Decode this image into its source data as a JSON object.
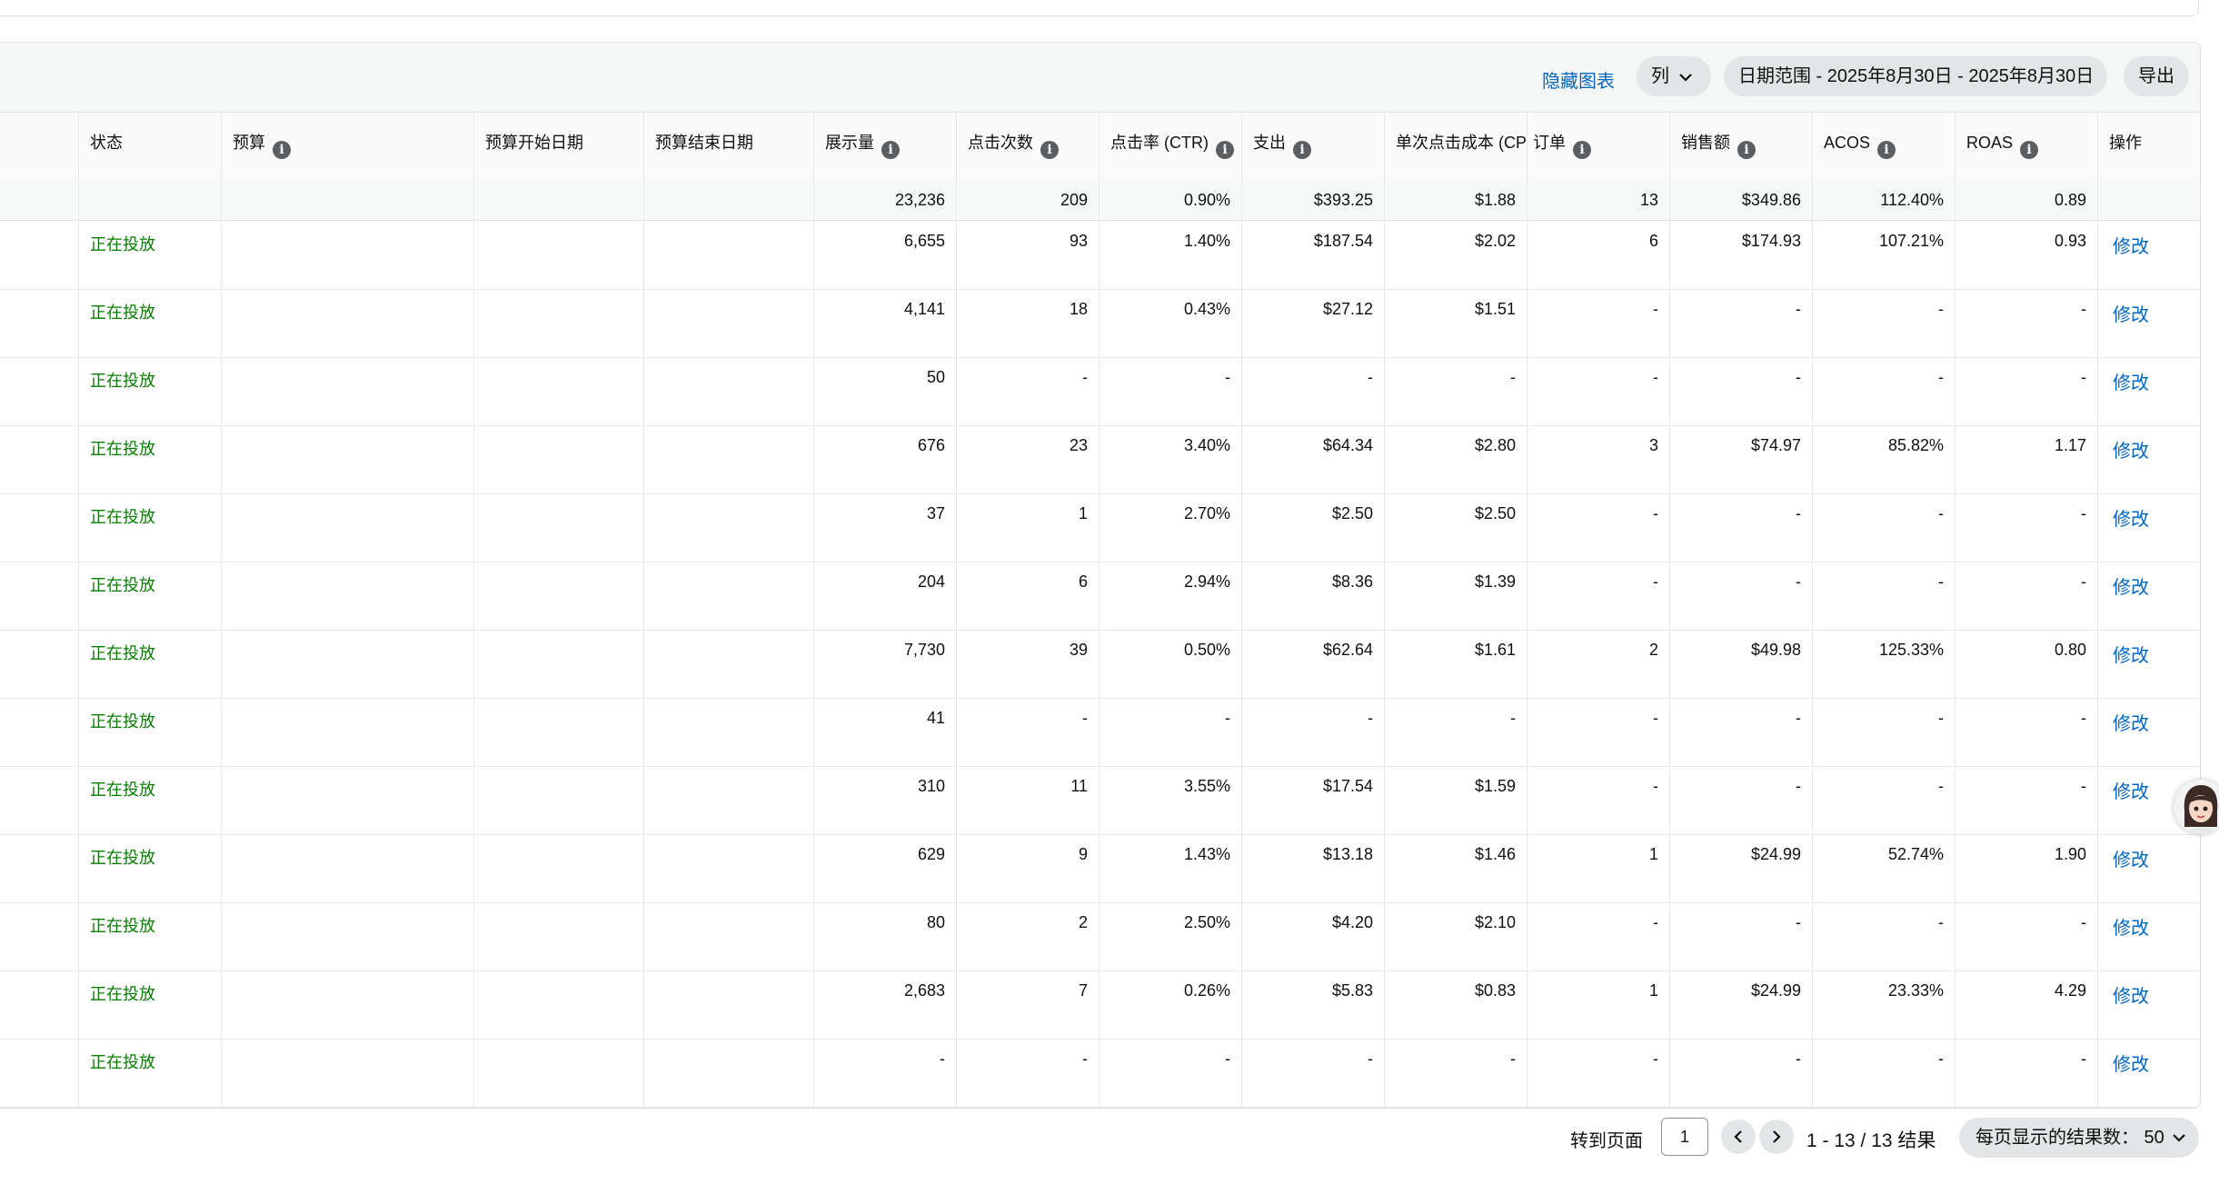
{
  "toolbar": {
    "hide_chart": "隐藏图表",
    "columns": "列",
    "date_range": "日期范围 - 2025年8月30日 - 2025年8月30日",
    "export": "导出"
  },
  "columns": [
    "状态",
    "预算",
    "预算开始日期",
    "预算结束日期",
    "展示量",
    "点击次数",
    "点击率 (CTR)",
    "支出",
    "单次点击成本 (CPC)",
    "订单",
    "销售额",
    "ACOS",
    "ROAS",
    "操作"
  ],
  "totals": {
    "impressions": "23,236",
    "clicks": "209",
    "ctr": "0.90%",
    "spend": "$393.25",
    "cpc": "$1.88",
    "orders": "13",
    "sales": "$349.86",
    "acos": "112.40%",
    "roas": "0.89"
  },
  "rows": [
    {
      "status": "正在投放",
      "impressions": "6,655",
      "clicks": "93",
      "ctr": "1.40%",
      "spend": "$187.54",
      "cpc": "$2.02",
      "orders": "6",
      "sales": "$174.93",
      "acos": "107.21%",
      "roas": "0.93",
      "action": "修改"
    },
    {
      "status": "正在投放",
      "impressions": "4,141",
      "clicks": "18",
      "ctr": "0.43%",
      "spend": "$27.12",
      "cpc": "$1.51",
      "orders": "-",
      "sales": "-",
      "acos": "-",
      "roas": "-",
      "action": "修改"
    },
    {
      "status": "正在投放",
      "impressions": "50",
      "clicks": "-",
      "ctr": "-",
      "spend": "-",
      "cpc": "-",
      "orders": "-",
      "sales": "-",
      "acos": "-",
      "roas": "-",
      "action": "修改"
    },
    {
      "status": "正在投放",
      "impressions": "676",
      "clicks": "23",
      "ctr": "3.40%",
      "spend": "$64.34",
      "cpc": "$2.80",
      "orders": "3",
      "sales": "$74.97",
      "acos": "85.82%",
      "roas": "1.17",
      "action": "修改"
    },
    {
      "status": "正在投放",
      "impressions": "37",
      "clicks": "1",
      "ctr": "2.70%",
      "spend": "$2.50",
      "cpc": "$2.50",
      "orders": "-",
      "sales": "-",
      "acos": "-",
      "roas": "-",
      "action": "修改"
    },
    {
      "status": "正在投放",
      "impressions": "204",
      "clicks": "6",
      "ctr": "2.94%",
      "spend": "$8.36",
      "cpc": "$1.39",
      "orders": "-",
      "sales": "-",
      "acos": "-",
      "roas": "-",
      "action": "修改"
    },
    {
      "status": "正在投放",
      "impressions": "7,730",
      "clicks": "39",
      "ctr": "0.50%",
      "spend": "$62.64",
      "cpc": "$1.61",
      "orders": "2",
      "sales": "$49.98",
      "acos": "125.33%",
      "roas": "0.80",
      "action": "修改"
    },
    {
      "status": "正在投放",
      "impressions": "41",
      "clicks": "-",
      "ctr": "-",
      "spend": "-",
      "cpc": "-",
      "orders": "-",
      "sales": "-",
      "acos": "-",
      "roas": "-",
      "action": "修改"
    },
    {
      "status": "正在投放",
      "impressions": "310",
      "clicks": "11",
      "ctr": "3.55%",
      "spend": "$17.54",
      "cpc": "$1.59",
      "orders": "-",
      "sales": "-",
      "acos": "-",
      "roas": "-",
      "action": "修改"
    },
    {
      "status": "正在投放",
      "impressions": "629",
      "clicks": "9",
      "ctr": "1.43%",
      "spend": "$13.18",
      "cpc": "$1.46",
      "orders": "1",
      "sales": "$24.99",
      "acos": "52.74%",
      "roas": "1.90",
      "action": "修改"
    },
    {
      "status": "正在投放",
      "impressions": "80",
      "clicks": "2",
      "ctr": "2.50%",
      "spend": "$4.20",
      "cpc": "$2.10",
      "orders": "-",
      "sales": "-",
      "acos": "-",
      "roas": "-",
      "action": "修改"
    },
    {
      "status": "正在投放",
      "impressions": "2,683",
      "clicks": "7",
      "ctr": "0.26%",
      "spend": "$5.83",
      "cpc": "$0.83",
      "orders": "1",
      "sales": "$24.99",
      "acos": "23.33%",
      "roas": "4.29",
      "action": "修改"
    },
    {
      "status": "正在投放",
      "impressions": "-",
      "clicks": "-",
      "ctr": "-",
      "spend": "-",
      "cpc": "-",
      "orders": "-",
      "sales": "-",
      "acos": "-",
      "roas": "-",
      "action": "修改"
    }
  ],
  "pagination": {
    "go_to_page": "转到页面",
    "current_page": "1",
    "results": "1 - 13 / 13 结果",
    "per_page": "每页显示的结果数： 50"
  },
  "colors": {
    "status_active": "#067d00",
    "link": "#0066c0",
    "pill_bg": "#e3e6e6"
  },
  "icons": {
    "info": "info-icon",
    "dropdown": "chevron-down-icon",
    "prev": "chevron-left-icon",
    "next": "chevron-right-icon",
    "assistant": "assistant-avatar"
  }
}
